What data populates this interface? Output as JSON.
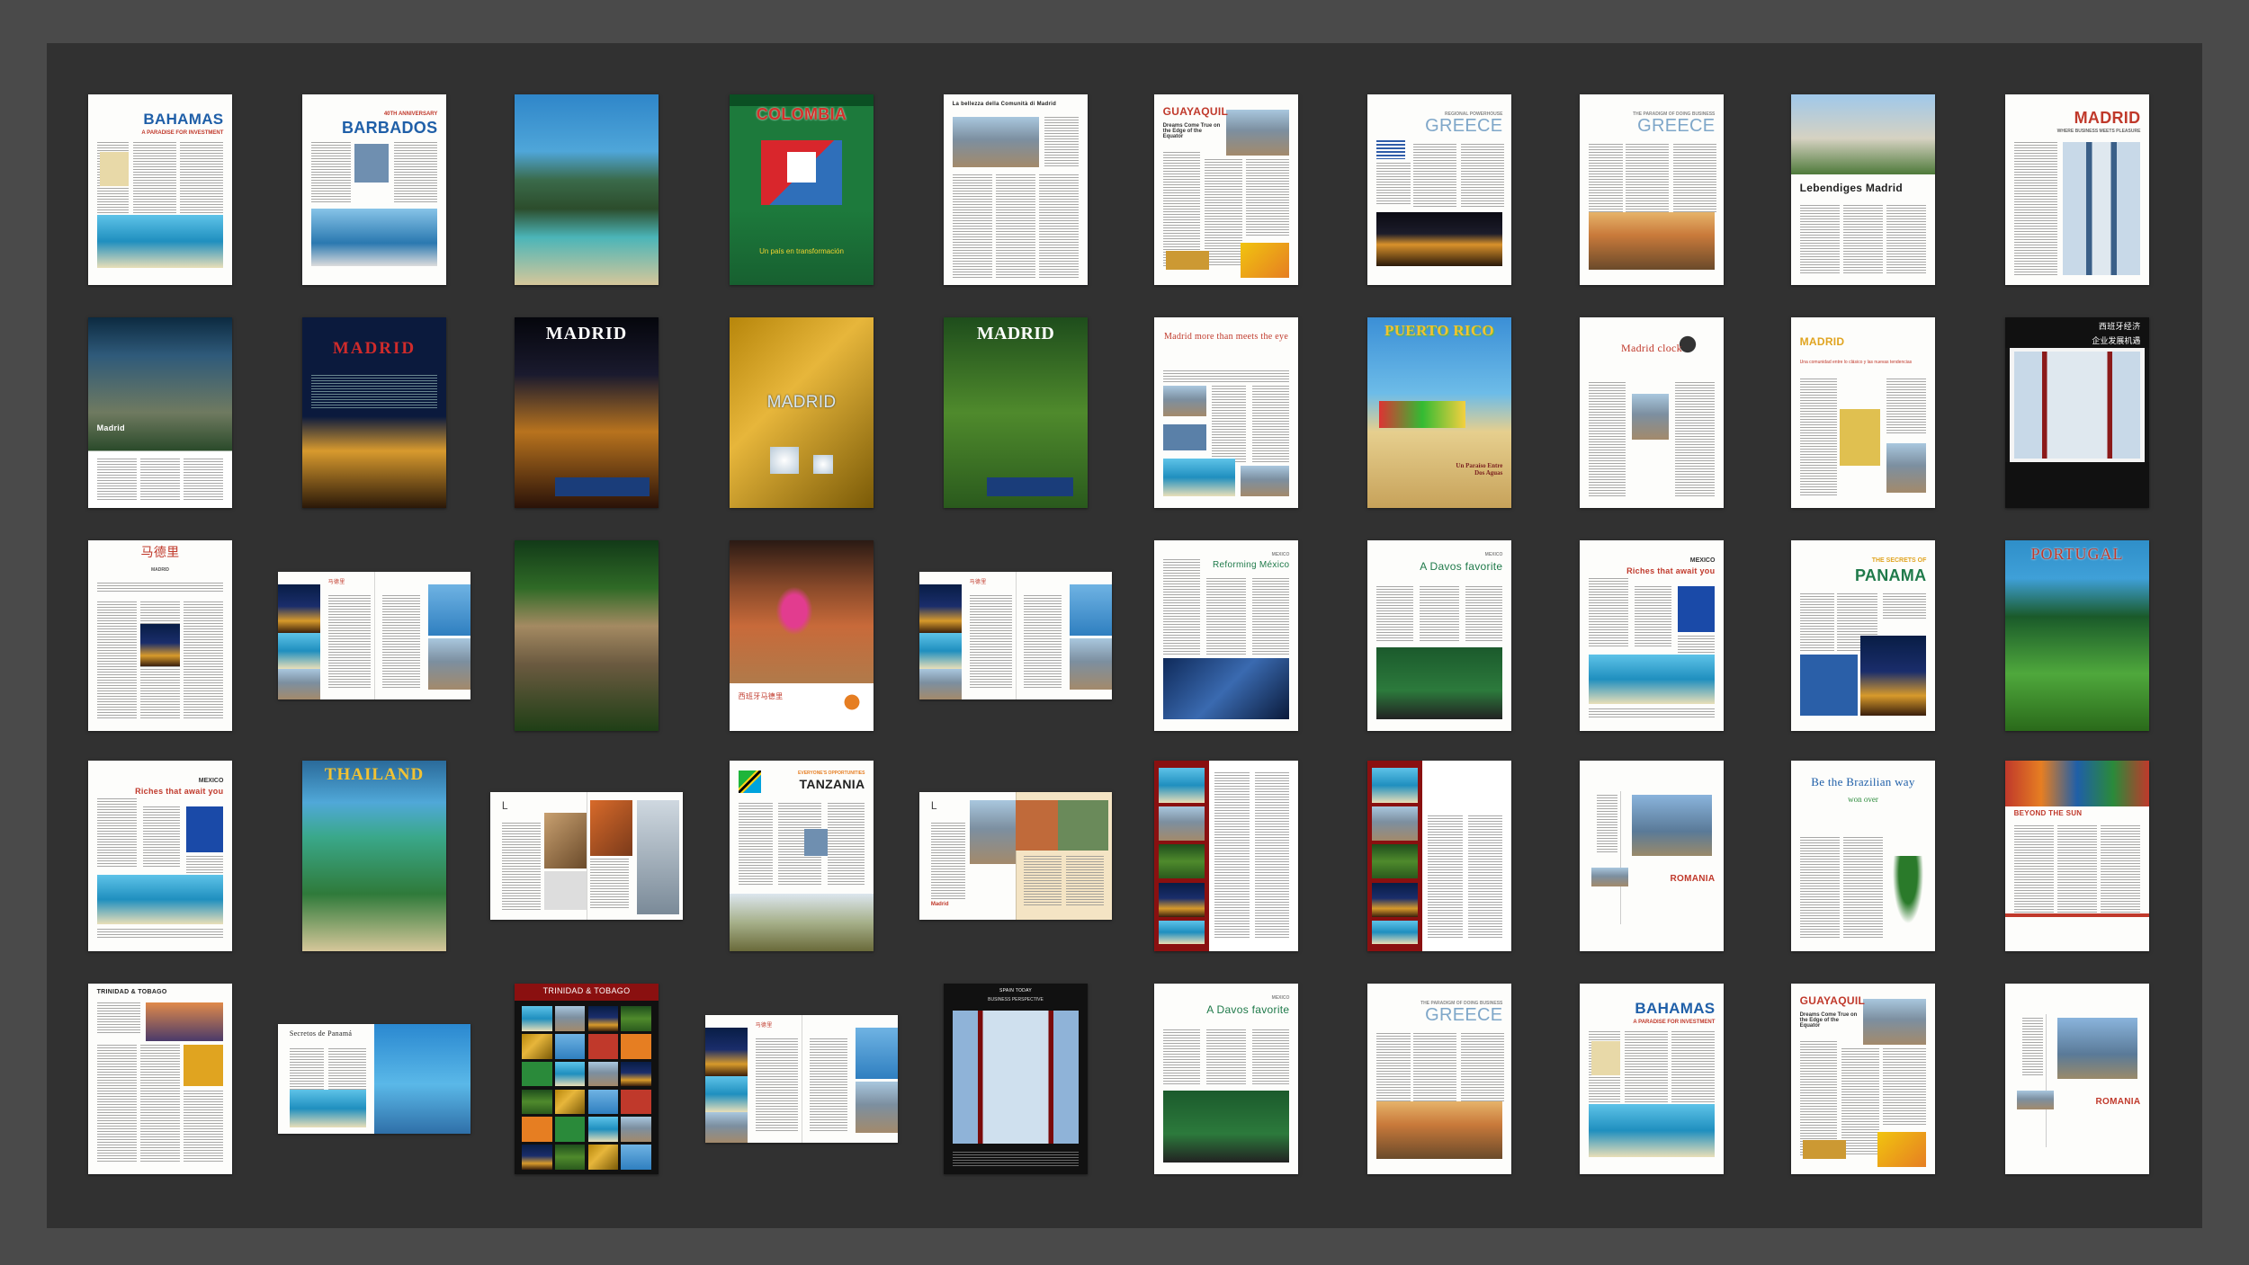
{
  "colors": {
    "board": "#313131",
    "page": "#fdfdfb",
    "accent_red": "#c0392b",
    "accent_blue": "#1f5fa8"
  },
  "thumbnails": [
    {
      "id": "bahamas-1",
      "title": "BAHAMAS",
      "subtitle": "A PARADISE FOR INVESTMENT",
      "style": "bahamas"
    },
    {
      "id": "barbados",
      "title": "BARBADOS",
      "subtitle": "40TH ANNIVERSARY",
      "style": "barbados"
    },
    {
      "id": "coast-photo",
      "title": "",
      "subtitle": "",
      "style": "coast"
    },
    {
      "id": "colombia",
      "title": "COLOMBIA",
      "subtitle": "Un país en transformación",
      "style": "colombia"
    },
    {
      "id": "madrid-it",
      "title": "La bellezza della Comunità di Madrid",
      "subtitle": "",
      "style": "italian"
    },
    {
      "id": "guayaquil-1",
      "title": "GUAYAQUIL",
      "subtitle": "Dreams Come True on the Edge of the Equator",
      "style": "guayaquil"
    },
    {
      "id": "greece-1",
      "title": "GREECE",
      "subtitle": "REGIONAL POWERHOUSE",
      "style": "greece-night"
    },
    {
      "id": "greece-2",
      "title": "GREECE",
      "subtitle": "THE PARADIGM OF DOING BUSINESS",
      "style": "greece-day"
    },
    {
      "id": "madrid-de",
      "title": "Lebendiges Madrid",
      "subtitle": "",
      "style": "lebendiges"
    },
    {
      "id": "madrid-1",
      "title": "MADRID",
      "subtitle": "WHERE BUSINESS MEETS PLEASURE",
      "style": "madrid-towers"
    },
    {
      "id": "madrid-escorial",
      "title": "Madrid",
      "subtitle": "",
      "style": "escorial"
    },
    {
      "id": "madrid-2",
      "title": "MADRID",
      "subtitle": "",
      "style": "madrid-blue"
    },
    {
      "id": "madrid-3",
      "title": "MADRID",
      "subtitle": "",
      "style": "madrid-night"
    },
    {
      "id": "madrid-4",
      "title": "MADRID",
      "subtitle": "",
      "style": "madrid-yellow"
    },
    {
      "id": "madrid-5",
      "title": "MADRID",
      "subtitle": "",
      "style": "madrid-green"
    },
    {
      "id": "madrid-eye",
      "title": "Madrid more than meets the eye",
      "subtitle": "",
      "style": "madrid-eye"
    },
    {
      "id": "puerto-rico",
      "title": "PUERTO RICO",
      "subtitle": "Un Paraíso Entre Dos Aguas",
      "style": "puerto-rico"
    },
    {
      "id": "madrid-clock",
      "title": "Madrid clock",
      "subtitle": "",
      "style": "madrid-clock"
    },
    {
      "id": "madrid-6",
      "title": "MADRID",
      "subtitle": "Una comunidad entre lo clásico y las nuevas tendencias",
      "style": "madrid-classic"
    },
    {
      "id": "madrid-zh",
      "title": "西班牙经济",
      "subtitle": "企业发展机遇",
      "style": "madrid-zh"
    },
    {
      "id": "madrid-zh-2",
      "title": "马德里",
      "subtitle": "MADRID",
      "style": "zh-page"
    },
    {
      "id": "madrid-zh-spread",
      "title": "马德里",
      "subtitle": "",
      "style": "zh-spread"
    },
    {
      "id": "escorial-photo",
      "title": "",
      "subtitle": "",
      "style": "escorial-photo"
    },
    {
      "id": "bullfight",
      "title": "西班牙马德里",
      "subtitle": "",
      "style": "bullfight"
    },
    {
      "id": "madrid-zh-spread-2",
      "title": "马德里",
      "subtitle": "",
      "style": "zh-spread2"
    },
    {
      "id": "mexico-1",
      "title": "Reforming México",
      "subtitle": "MEXICO",
      "style": "mexico-reform"
    },
    {
      "id": "mexico-2",
      "title": "A Davos favorite",
      "subtitle": "MEXICO",
      "style": "mexico-davos"
    },
    {
      "id": "mexico-3",
      "title": "Riches that await you",
      "subtitle": "MEXICO",
      "style": "mexico-riches"
    },
    {
      "id": "panama",
      "title": "PANAMA",
      "subtitle": "THE SECRETS OF",
      "style": "panama"
    },
    {
      "id": "portugal",
      "title": "PORTUGAL",
      "subtitle": "",
      "style": "portugal"
    },
    {
      "id": "mexico-4",
      "title": "Riches that await you",
      "subtitle": "MEXICO",
      "style": "mexico-riches"
    },
    {
      "id": "thailand",
      "title": "THAILAND",
      "subtitle": "",
      "style": "thailand"
    },
    {
      "id": "spread-architecture",
      "title": "L",
      "subtitle": "",
      "style": "arch-spread"
    },
    {
      "id": "tanzania",
      "title": "TANZANIA",
      "subtitle": "EVERYONE'S OPPORTUNITIES",
      "style": "tanzania"
    },
    {
      "id": "madrid-spread",
      "title": "L",
      "subtitle": "Madrid",
      "style": "madrid-spread"
    },
    {
      "id": "red-collage-1",
      "title": "",
      "subtitle": "",
      "style": "red-collage"
    },
    {
      "id": "red-collage-2",
      "title": "",
      "subtitle": "",
      "style": "red-collage2"
    },
    {
      "id": "romania-1",
      "title": "ROMANIA",
      "subtitle": "",
      "style": "romania"
    },
    {
      "id": "brazil",
      "title": "Be the Brazilian way",
      "subtitle": "won over",
      "style": "brazil"
    },
    {
      "id": "beyond-sun",
      "title": "BEYOND THE SUN",
      "subtitle": "",
      "style": "beyond-sun"
    },
    {
      "id": "trinidad-1",
      "title": "TRINIDAD & TOBAGO",
      "subtitle": "",
      "style": "trinidad-page"
    },
    {
      "id": "panama-spread",
      "title": "Secretos de Panamá",
      "subtitle": "",
      "style": "panama-spread"
    },
    {
      "id": "trinidad-2",
      "title": "TRINIDAD & TOBAGO",
      "subtitle": "",
      "style": "trinidad-cover"
    },
    {
      "id": "zh-spread-3",
      "title": "马德里",
      "subtitle": "",
      "style": "zh-spread"
    },
    {
      "id": "towers-cover",
      "title": "SPAIN TODAY",
      "subtitle": "BUSINESS PERSPECTIVE",
      "style": "towers-cover"
    },
    {
      "id": "mexico-5",
      "title": "A Davos favorite",
      "subtitle": "MEXICO",
      "style": "mexico-davos"
    },
    {
      "id": "greece-3",
      "title": "GREECE",
      "subtitle": "THE PARADIGM OF DOING BUSINESS",
      "style": "greece-day"
    },
    {
      "id": "bahamas-2",
      "title": "BAHAMAS",
      "subtitle": "A PARADISE FOR INVESTMENT",
      "style": "bahamas"
    },
    {
      "id": "guayaquil-2",
      "title": "GUAYAQUIL",
      "subtitle": "Dreams Come True on the Edge of the Equator",
      "style": "guayaquil"
    },
    {
      "id": "romania-2",
      "title": "ROMANIA",
      "subtitle": "",
      "style": "romania"
    }
  ]
}
